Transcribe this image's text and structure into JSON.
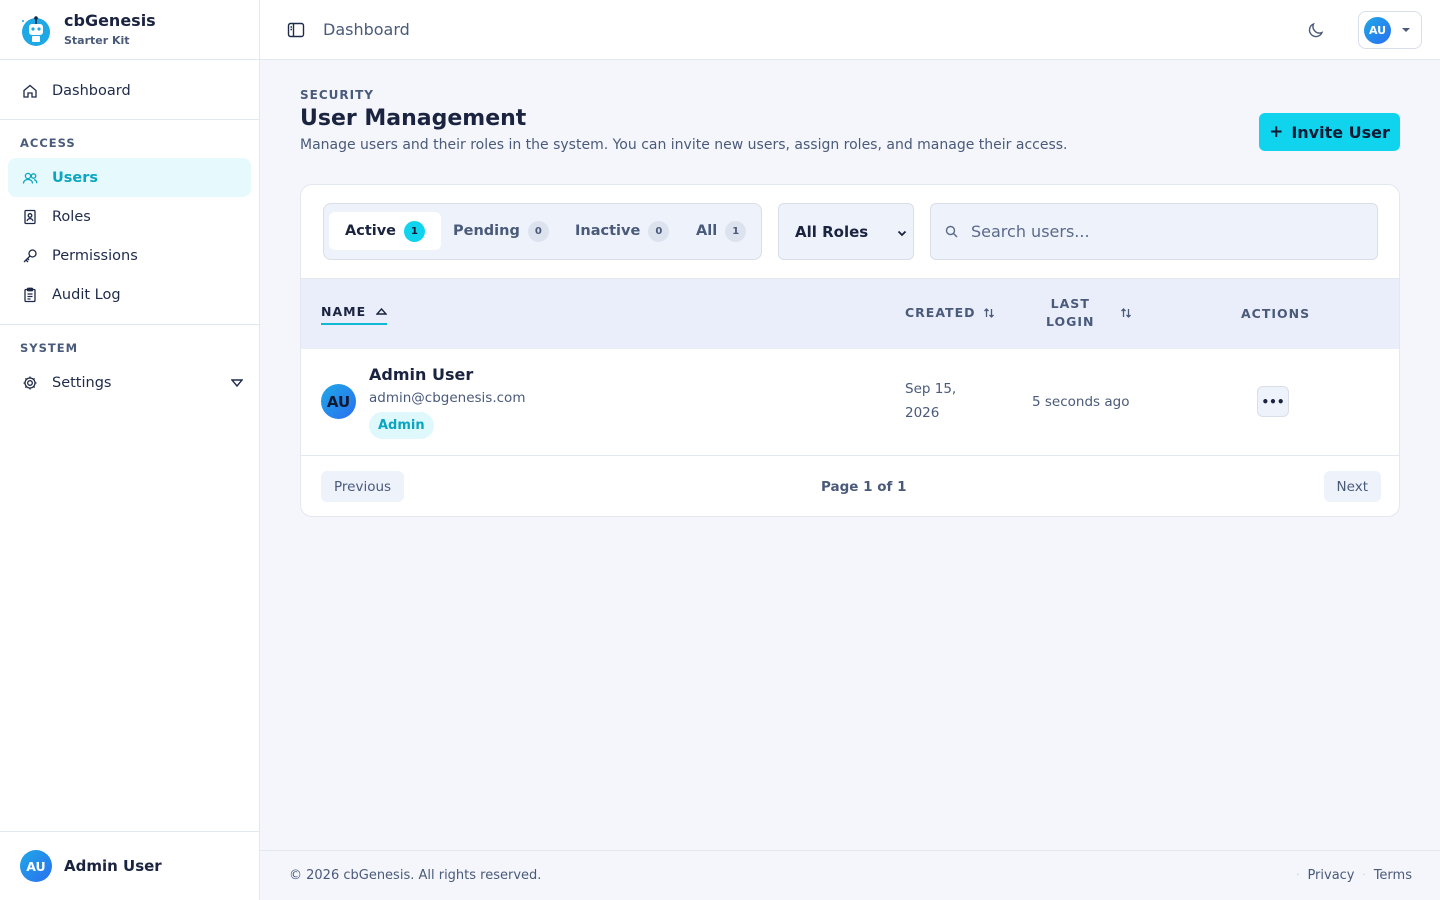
{
  "brand": {
    "name": "cbGenesis",
    "subtitle": "Starter Kit"
  },
  "sidebar": {
    "top_items": [
      {
        "label": "Dashboard",
        "icon": "home-icon"
      }
    ],
    "sections": [
      {
        "label": "ACCESS",
        "items": [
          {
            "label": "Users",
            "icon": "users-icon",
            "active": true
          },
          {
            "label": "Roles",
            "icon": "roles-icon"
          },
          {
            "label": "Permissions",
            "icon": "key-icon"
          },
          {
            "label": "Audit Log",
            "icon": "clipboard-icon"
          }
        ]
      },
      {
        "label": "SYSTEM",
        "items": [
          {
            "label": "Settings",
            "icon": "gear-icon",
            "expandable": true
          }
        ]
      }
    ],
    "user": {
      "initials": "AU",
      "name": "Admin User"
    }
  },
  "header": {
    "title": "Dashboard",
    "user_initials": "AU"
  },
  "page": {
    "eyebrow": "SECURITY",
    "title": "User Management",
    "description": "Manage users and their roles in the system. You can invite new users, assign roles, and manage their access.",
    "invite_label": "Invite User"
  },
  "tabs": [
    {
      "label": "Active",
      "count": "1",
      "active": true
    },
    {
      "label": "Pending",
      "count": "0"
    },
    {
      "label": "Inactive",
      "count": "0"
    },
    {
      "label": "All",
      "count": "1"
    }
  ],
  "filters": {
    "role_selected": "All Roles",
    "search_placeholder": "Search users..."
  },
  "table": {
    "headers": {
      "name": "NAME",
      "created": "CREATED",
      "last_login_1": "LAST",
      "last_login_2": "LOGIN",
      "actions": "ACTIONS"
    },
    "rows": [
      {
        "initials": "AU",
        "name": "Admin User",
        "email": "admin@cbgenesis.com",
        "role": "Admin",
        "created_1": "Sep 15,",
        "created_2": "2026",
        "last_login": "5 seconds ago",
        "actions_label": "•••"
      }
    ]
  },
  "pagination": {
    "prev": "Previous",
    "info": "Page 1 of 1",
    "next": "Next"
  },
  "footer": {
    "copyright": "© 2026 cbGenesis. All rights reserved.",
    "privacy": "Privacy",
    "terms": "Terms"
  },
  "colors": {
    "accent": "#10d3ee",
    "active_text": "#0aa5c0",
    "text_dark": "#1a2340",
    "text_muted": "#4a5a7a"
  }
}
